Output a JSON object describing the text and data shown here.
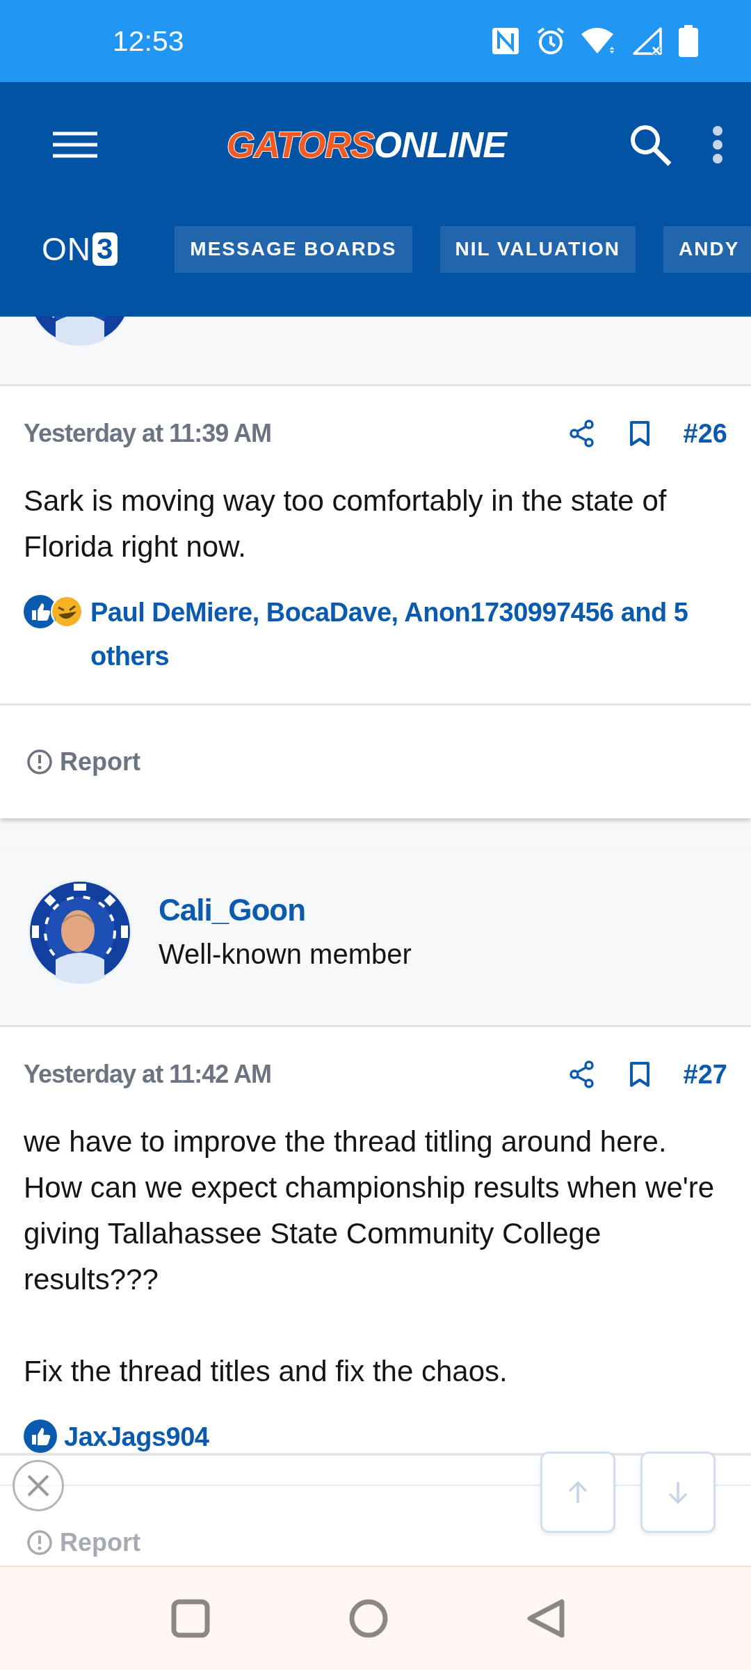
{
  "status_bar": {
    "time": "12:53"
  },
  "header": {
    "logo": {
      "left": "GATORS",
      "right": "ONLINE"
    },
    "brand": {
      "text": "ON",
      "badge": "3"
    },
    "tabs": [
      {
        "label": "MESSAGE BOARDS"
      },
      {
        "label": "NIL VALUATION"
      },
      {
        "label": "ANDY"
      }
    ]
  },
  "posts": [
    {
      "time": "Yesterday at 11:39 AM",
      "number": "#26",
      "body": [
        "Sark is moving way too comfortably in the state of Florida right now."
      ],
      "reactions": {
        "icons": [
          {
            "kind": "like"
          },
          {
            "kind": "laugh"
          }
        ],
        "text": "Paul DeMiere, BocaDave, Anon1730997456 and 5 others"
      },
      "report": "Report"
    },
    {
      "author": {
        "name": "Cali_Goon",
        "role": "Well-known member"
      },
      "time": "Yesterday at 11:42 AM",
      "number": "#27",
      "body": [
        "we have to improve the thread titling around here. How can we expect championship results when we're giving Tallahassee State Community College results???",
        "Fix the thread titles and fix the chaos."
      ],
      "reactions": {
        "icons": [
          {
            "kind": "like"
          }
        ],
        "text": "JaxJags904"
      },
      "report": "Report"
    }
  ]
}
